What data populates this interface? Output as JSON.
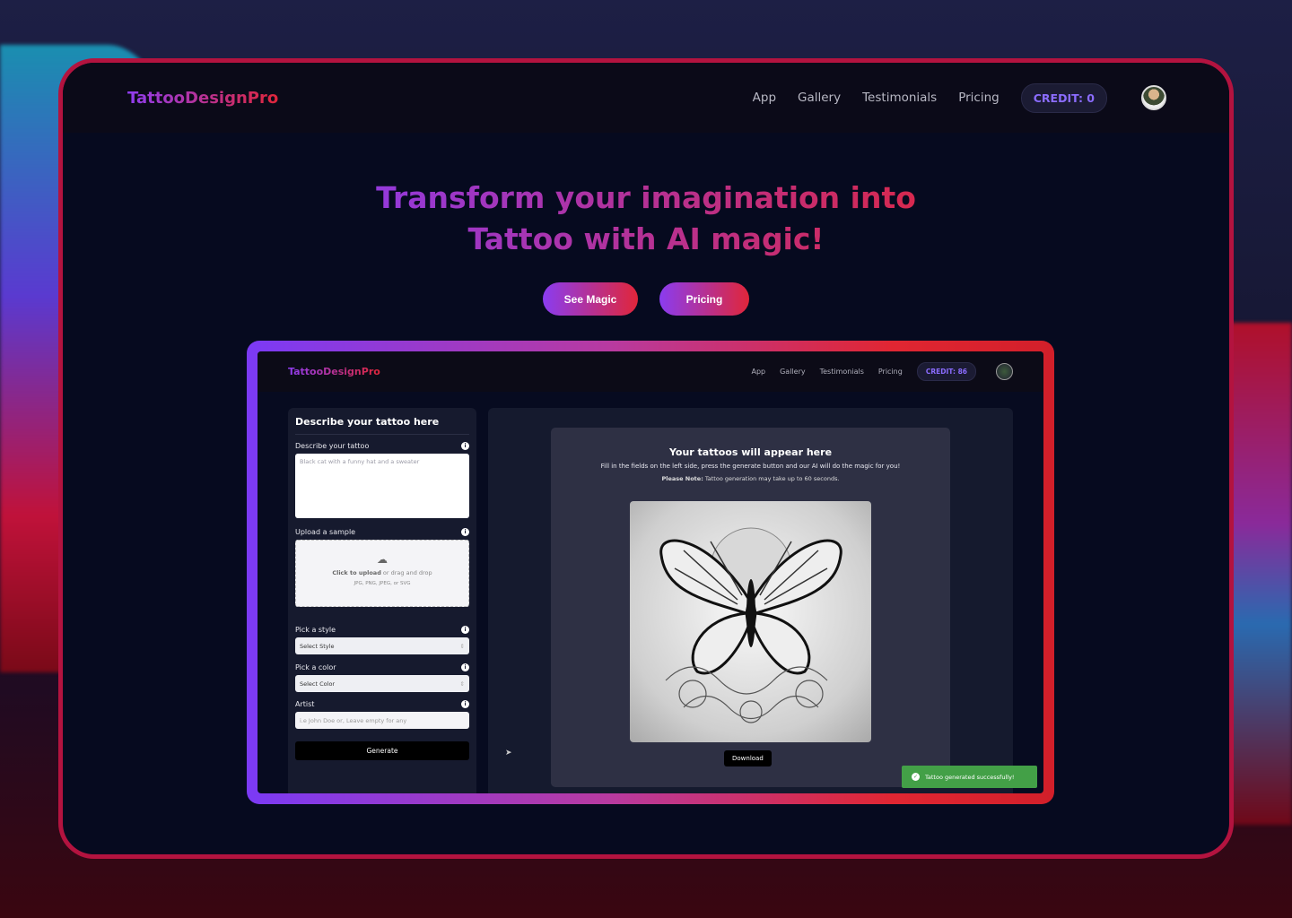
{
  "header": {
    "logo": "TattooDesignPro",
    "nav": [
      "App",
      "Gallery",
      "Testimonials",
      "Pricing"
    ],
    "credit": "CREDIT: 0"
  },
  "hero": {
    "line1": "Transform your imagination into",
    "line2": "Tattoo with AI magic!",
    "see_magic": "See Magic",
    "pricing": "Pricing"
  },
  "mock": {
    "header": {
      "logo": "TattooDesignPro",
      "nav": [
        "App",
        "Gallery",
        "Testimonials",
        "Pricing"
      ],
      "credit": "CREDIT: 86"
    },
    "form": {
      "title": "Describe your tattoo here",
      "describe_label": "Describe your tattoo",
      "describe_placeholder": "Black cat with a funny hat and a sweater",
      "upload_label": "Upload a sample",
      "upload_click": "Click to upload",
      "upload_rest": " or drag and drop",
      "upload_types": "JPG, PNG, JPEG, or SVG",
      "style_label": "Pick a style",
      "style_value": "Select Style",
      "color_label": "Pick a color",
      "color_value": "Select Color",
      "artist_label": "Artist",
      "artist_placeholder": "i.e John Doe or, Leave empty for any",
      "generate": "Generate"
    },
    "result": {
      "title": "Your tattoos will appear here",
      "subtitle": "Fill in the fields on the left side, press the generate button and our AI will do the magic for you!",
      "note_label": "Please Note:",
      "note": " Tattoo generation may take up to 60 seconds.",
      "download": "Download"
    },
    "toast": "Tattoo generated successfully!"
  },
  "colors": {
    "frame": "#b3133f",
    "gradient_start": "#8a3cf0",
    "gradient_end": "#e0263a",
    "toast": "#43a047"
  }
}
